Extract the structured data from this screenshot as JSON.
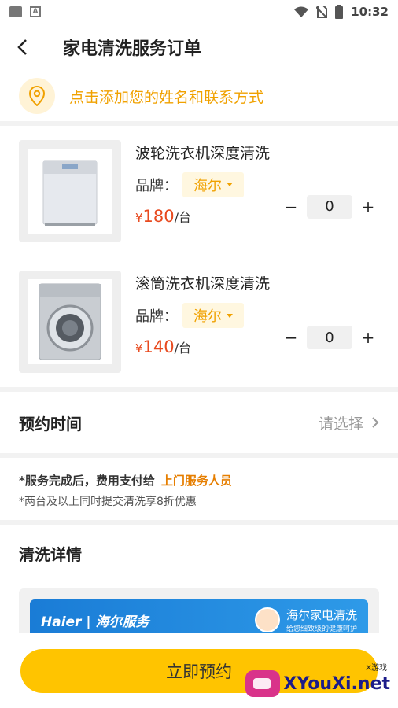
{
  "status_bar": {
    "time": "10:32"
  },
  "header": {
    "title": "家电清洗服务订单"
  },
  "address": {
    "prompt": "点击添加您的姓名和联系方式"
  },
  "products": [
    {
      "name": "波轮洗衣机深度清洗",
      "brand_label": "品牌：",
      "brand": "海尔",
      "currency": "¥",
      "price": "180",
      "unit": "/台",
      "quantity": "0",
      "minus": "−",
      "plus": "+"
    },
    {
      "name": "滚筒洗衣机深度清洗",
      "brand_label": "品牌：",
      "brand": "海尔",
      "currency": "¥",
      "price": "140",
      "unit": "/台",
      "quantity": "0",
      "minus": "−",
      "plus": "+"
    }
  ],
  "appointment": {
    "label": "预约时间",
    "placeholder": "请选择"
  },
  "notes": {
    "line1": "*服务完成后，费用支付给",
    "line1_highlight": "上门服务人员",
    "line2": "*两台及以上同时提交清洗享8折优惠"
  },
  "details": {
    "title": "清洗详情",
    "banner_left": "Haier | 海尔服务",
    "banner_title": "海尔家电清洗",
    "banner_sub": "给您细致级的健康呵护"
  },
  "actions": {
    "book_label": "立即预约"
  },
  "watermark": {
    "text": "XYouXi.net",
    "small": "X游戏"
  },
  "colors": {
    "accent": "#ffc400",
    "price": "#e84a1f",
    "brand": "#f0a100",
    "highlight": "#e67e00"
  },
  "icons": [
    "back-arrow-icon",
    "location-pin-icon",
    "chevron-right-icon",
    "caret-down-icon"
  ]
}
